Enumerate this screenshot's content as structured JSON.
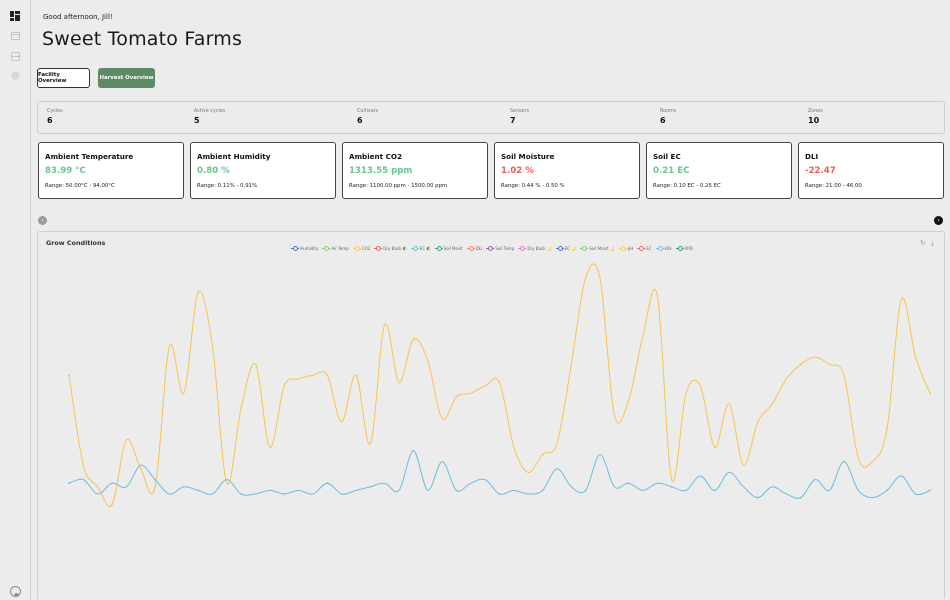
{
  "sidebar": {
    "icons": [
      "dashboard-icon",
      "calendar-icon",
      "grid-icon",
      "settings-icon"
    ],
    "avatar": "user-avatar"
  },
  "header": {
    "greeting": "Good afternoon, Jill!",
    "title": "Sweet Tomato Farms"
  },
  "tabs": {
    "facility": "Facility Overview",
    "harvest": "Harvest Overview"
  },
  "stats": [
    {
      "label": "Cycles",
      "value": "6"
    },
    {
      "label": "Active cycles",
      "value": "5"
    },
    {
      "label": "Cultivars",
      "value": "6"
    },
    {
      "label": "Sensors",
      "value": "7"
    },
    {
      "label": "Rooms",
      "value": "6"
    },
    {
      "label": "Zones",
      "value": "10"
    }
  ],
  "cards": [
    {
      "title": "Ambient Temperature",
      "value": "83.99 °C",
      "range": "Range: 50.00°C - 94.00°C",
      "status": "ok"
    },
    {
      "title": "Ambient Humidity",
      "value": "0.80 %",
      "range": "Range: 0.11% - 0.91%",
      "status": "ok"
    },
    {
      "title": "Ambient CO2",
      "value": "1313.55 ppm",
      "range": "Range: 1100.00 ppm - 1500.00 ppm",
      "status": "ok"
    },
    {
      "title": "Soil Moisture",
      "value": "1.02 %",
      "range": "Range: 0.44 % - 0.50 %",
      "status": "alert"
    },
    {
      "title": "Soil EC",
      "value": "0.21 EC",
      "range": "Range: 0.10 EC - 0.25 EC",
      "status": "ok"
    },
    {
      "title": "DLI",
      "value": "-22.47",
      "range": "Range: 21.00 - 46.00",
      "status": "alert"
    }
  ],
  "colors": {
    "ok": "#6cc58a",
    "alert": "#ee5a5a",
    "accent": "#5f8a66",
    "co2_line": "#f9c24f",
    "humidity_line": "#6bbde2"
  },
  "chart": {
    "title": "Grow Conditions",
    "legend": [
      {
        "name": "Humidity",
        "color": "#5470c6"
      },
      {
        "name": "Air Temp",
        "color": "#91cc75"
      },
      {
        "name": "CO2",
        "color": "#fac858"
      },
      {
        "name": "Dry Back 🌓",
        "color": "#ee6666"
      },
      {
        "name": "EC 🌓",
        "color": "#73c0de"
      },
      {
        "name": "Soil Moist",
        "color": "#3ba272"
      },
      {
        "name": "DLI",
        "color": "#fc8452"
      },
      {
        "name": "Soil Temp",
        "color": "#9a60b4"
      },
      {
        "name": "Dry Back 🌙",
        "color": "#ea7ccc"
      },
      {
        "name": "EC 🌙",
        "color": "#5470c6"
      },
      {
        "name": "Soil Moist 🌙",
        "color": "#91cc75"
      },
      {
        "name": "pH",
        "color": "#fac858"
      },
      {
        "name": "EC",
        "color": "#ee6666"
      },
      {
        "name": "kPa",
        "color": "#73c0de"
      },
      {
        "name": "VPD",
        "color": "#3ba272"
      }
    ]
  },
  "chart_data": {
    "type": "line",
    "title": "Grow Conditions",
    "xlabel": "",
    "ylabel": "",
    "grid": false,
    "legend_position": "top-center",
    "series": [
      {
        "name": "CO2",
        "color": "#f9c24f",
        "values": [
          0.63,
          0.38,
          0.32,
          0.27,
          0.45,
          0.37,
          0.32,
          0.71,
          0.58,
          0.86,
          0.71,
          0.33,
          0.54,
          0.66,
          0.43,
          0.6,
          0.62,
          0.63,
          0.63,
          0.5,
          0.63,
          0.44,
          0.77,
          0.61,
          0.73,
          0.67,
          0.51,
          0.57,
          0.58,
          0.6,
          0.61,
          0.43,
          0.36,
          0.41,
          0.44,
          0.66,
          0.9,
          0.9,
          0.52,
          0.56,
          0.74,
          0.85,
          0.34,
          0.58,
          0.6,
          0.43,
          0.55,
          0.38,
          0.5,
          0.55,
          0.62,
          0.66,
          0.68,
          0.66,
          0.63,
          0.4,
          0.39,
          0.48,
          0.84,
          0.68,
          0.58
        ]
      },
      {
        "name": "kPa",
        "color": "#6bbde2",
        "values": [
          0.33,
          0.34,
          0.3,
          0.33,
          0.32,
          0.38,
          0.34,
          0.3,
          0.32,
          0.31,
          0.3,
          0.34,
          0.3,
          0.3,
          0.31,
          0.3,
          0.31,
          0.3,
          0.33,
          0.3,
          0.31,
          0.32,
          0.33,
          0.31,
          0.42,
          0.31,
          0.39,
          0.31,
          0.33,
          0.34,
          0.3,
          0.31,
          0.3,
          0.31,
          0.37,
          0.32,
          0.31,
          0.41,
          0.32,
          0.33,
          0.31,
          0.33,
          0.32,
          0.31,
          0.35,
          0.31,
          0.36,
          0.32,
          0.29,
          0.32,
          0.3,
          0.29,
          0.34,
          0.31,
          0.39,
          0.31,
          0.29,
          0.31,
          0.35,
          0.3,
          0.31
        ]
      }
    ]
  }
}
